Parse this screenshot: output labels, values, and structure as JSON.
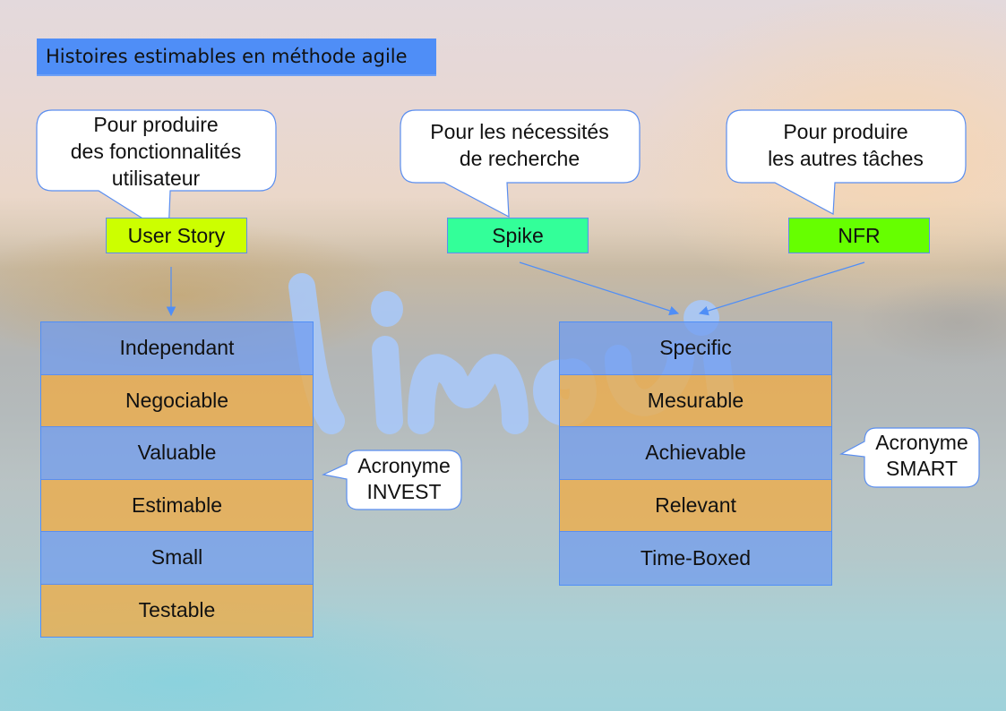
{
  "title": "Histoires estimables en méthode agile",
  "watermark_icon": "lingoui-logo",
  "colors": {
    "accent_blue": "#4f8ef7",
    "user_story": "#ccff00",
    "spike": "#33ff99",
    "nfr": "#66ff00",
    "row_blue": "#7a9fe0",
    "row_orange": "#e6ab55"
  },
  "callouts": [
    {
      "id": "user-story-purpose",
      "text": "Pour produire\ndes fonctionnalités\nutilisateur"
    },
    {
      "id": "spike-purpose",
      "text": "Pour les nécessités\nde recherche"
    },
    {
      "id": "nfr-purpose",
      "text": "Pour produire\nles autres tâches"
    }
  ],
  "story_types": [
    {
      "label": "User Story"
    },
    {
      "label": "Spike"
    },
    {
      "label": "NFR"
    }
  ],
  "invest": {
    "callout": "Acronyme\nINVEST",
    "items": [
      "Independant",
      "Negociable",
      "Valuable",
      "Estimable",
      "Small",
      "Testable"
    ]
  },
  "smart": {
    "callout": "Acronyme\nSMART",
    "items": [
      "Specific",
      "Mesurable",
      "Achievable",
      "Relevant",
      "Time-Boxed"
    ]
  }
}
